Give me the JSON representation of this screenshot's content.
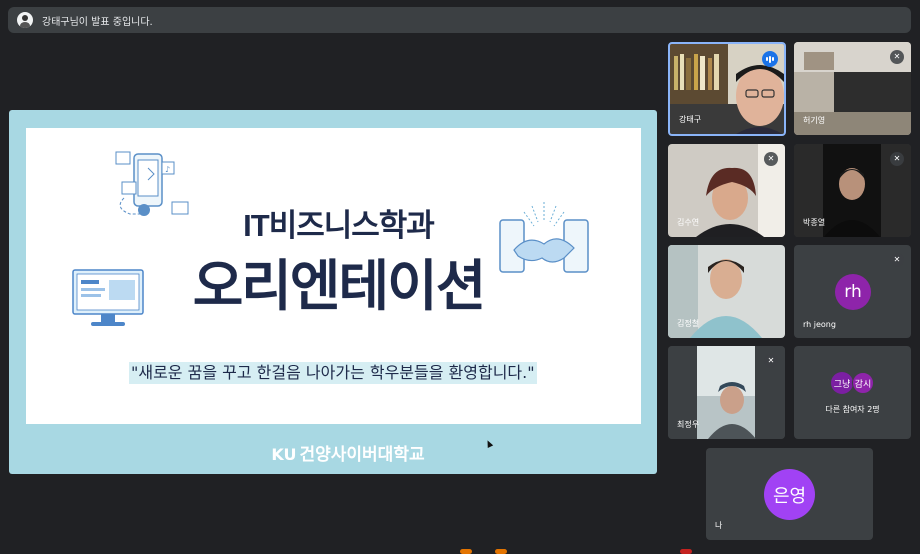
{
  "banner": {
    "message": "강태구님이 발표 중입니다."
  },
  "slide": {
    "title_line1": "IT비즈니스학과",
    "title_line2": "오리엔테이션",
    "tagline": "\"새로운 꿈을 꾸고 한걸음 나아가는 학우분들을 환영합니다.\"",
    "footer": "건양사이버대학교",
    "footer_logo": "KU"
  },
  "participants": [
    {
      "name": "강태구",
      "speaking": true,
      "muted": false
    },
    {
      "name": "허기영",
      "speaking": false,
      "muted": true
    },
    {
      "name": "김수연",
      "speaking": false,
      "muted": true
    },
    {
      "name": "박종열",
      "speaking": false,
      "muted": true
    },
    {
      "name": "김정철",
      "speaking": false,
      "muted": false
    },
    {
      "name": "rh jeong",
      "initials": "rh",
      "avatar_color": "#8e24aa",
      "muted": true
    },
    {
      "name": "최정우",
      "speaking": false,
      "muted": true
    }
  ],
  "others": {
    "avatar1": "그냥",
    "avatar2": "감시",
    "label": "다른 참여자 2명"
  },
  "self_tile": {
    "initials": "은영",
    "name": "나",
    "avatar_color": "#a142f4"
  },
  "icons": {
    "mic_off": "mic-off-icon",
    "speaking": "audio-level-icon",
    "presenter": "presenter-avatar-icon"
  }
}
